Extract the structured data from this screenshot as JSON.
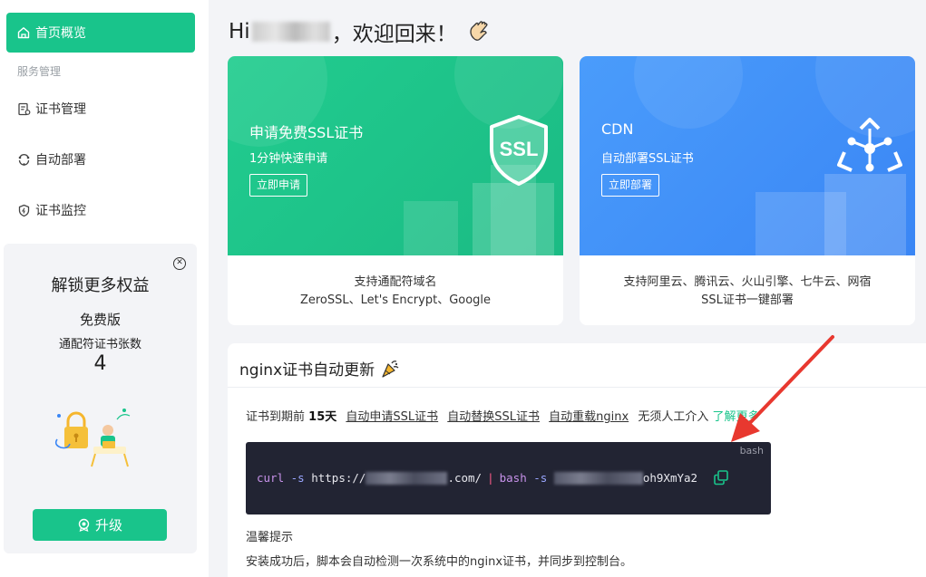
{
  "sidebar": {
    "active_item": "首页概览",
    "section_label": "服务管理",
    "items": [
      "证书管理",
      "自动部署",
      "证书监控"
    ],
    "promo": {
      "title": "解锁更多权益",
      "plan": "免费版",
      "count_label": "通配符证书张数",
      "count": "4",
      "upgrade_label": "升级"
    }
  },
  "greeting": {
    "prefix": "Hi",
    "suffix": "，欢迎回来！",
    "emoji_icon": "waving-hand-icon"
  },
  "cards": {
    "ssl": {
      "title": "申请免费SSL证书",
      "subtitle": "1分钟快速申请",
      "button": "立即申请",
      "badge": "SSL",
      "desc_line1": "支持通配符域名",
      "desc_line2": "ZeroSSL、Let's Encrypt、Google"
    },
    "cdn": {
      "title": "CDN",
      "subtitle": "自动部署SSL证书",
      "button": "立即部署",
      "desc_line1": "支持阿里云、腾讯云、火山引擎、七牛云、网宿",
      "desc_line2": "SSL证书一键部署"
    }
  },
  "panel": {
    "title": "nginx证书自动更新",
    "steps_prefix": "证书到期前",
    "steps_days": "15天",
    "step1": "自动申请SSL证书",
    "step2": "自动替换SSL证书",
    "step3": "自动重载nginx",
    "steps_suffix": "无须人工介入",
    "learn_more": "了解更多",
    "code": {
      "lang": "bash",
      "cmd_curl": "curl",
      "flag1": "-s",
      "url_prefix": "https://",
      "url_suffix": ".com/",
      "pipe": "|",
      "cmd_bash": "bash",
      "flag2": "-s",
      "token_suffix": "oh9XmYa2"
    },
    "tip_title": "温馨提示",
    "tip_text": "安装成功后，脚本会自动检测一次系统中的nginx证书，并同步到控制台。"
  },
  "colors": {
    "brand_green": "#19c48b",
    "brand_blue": "#3a86f5",
    "code_bg": "#222433",
    "annotation_red": "#e8382f"
  }
}
